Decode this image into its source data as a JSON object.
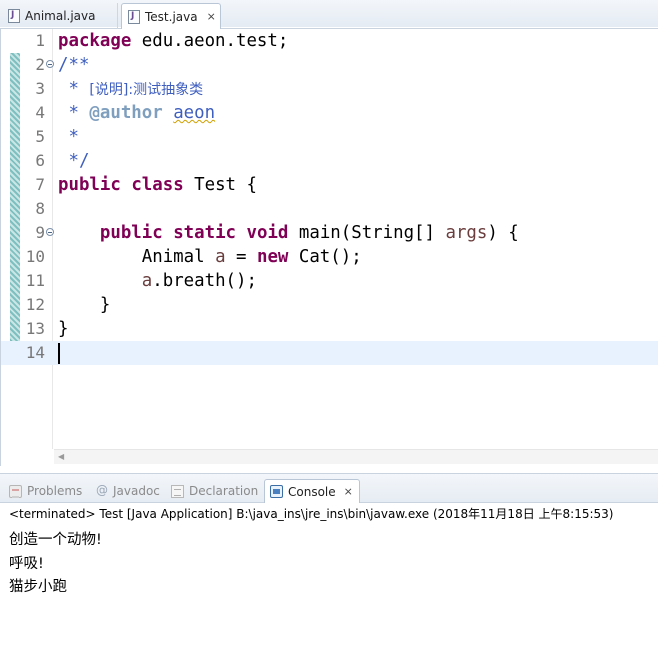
{
  "editor_tabs": [
    {
      "label": "Animal.java",
      "active": false
    },
    {
      "label": "Test.java",
      "active": true,
      "close": "⨯"
    }
  ],
  "code_lines": [
    {
      "num": "1"
    },
    {
      "num": "2"
    },
    {
      "num": "3"
    },
    {
      "num": "4"
    },
    {
      "num": "5"
    },
    {
      "num": "6"
    },
    {
      "num": "7"
    },
    {
      "num": "8"
    },
    {
      "num": "9"
    },
    {
      "num": "10"
    },
    {
      "num": "11"
    },
    {
      "num": "12"
    },
    {
      "num": "13"
    },
    {
      "num": "14"
    }
  ],
  "code": {
    "l1_kw": "package",
    "l1_rest": " edu.aeon.test;",
    "l2": "/**",
    "l3_star": " * ",
    "l3_tag": "[说明]",
    "l3_text": ":测试抽象类",
    "l4_star": " * ",
    "l4_tag": "@author",
    "l4_space": " ",
    "l4_text": "aeon",
    "l5": " *",
    "l6": " */",
    "l7_kw1": "public",
    "l7_sp": " ",
    "l7_kw2": "class",
    "l7_rest": " Test {",
    "l9_indent": "    ",
    "l9_kw1": "public",
    "l9_kw2": "static",
    "l9_kw3": "void",
    "l9_rest1": " main(String[] ",
    "l9_param": "args",
    "l9_rest2": ") {",
    "l10_pre": "        Animal ",
    "l10_var": "a",
    "l10_mid": " = ",
    "l10_kw": "new",
    "l10_rest": " Cat();",
    "l11_pre": "        ",
    "l11_var": "a",
    "l11_rest": ".breath();",
    "l12": "    }",
    "l13": "}"
  },
  "panel_tabs": {
    "problems": "Problems",
    "javadoc": "Javadoc",
    "declaration": "Declaration",
    "console": "Console",
    "close": "⨯"
  },
  "console": {
    "header": "<terminated> Test [Java Application] B:\\java_ins\\jre_ins\\bin\\javaw.exe (2018年11月18日 上午8:15:53)",
    "output": [
      "创造一个动物!",
      "呼吸!",
      "猫步小跑"
    ]
  },
  "colors": {
    "keyword": "#7f0055",
    "comment": "#3f5fbf",
    "javadoc_tag": "#7f9fbf",
    "current_line": "#e8f2fe"
  }
}
